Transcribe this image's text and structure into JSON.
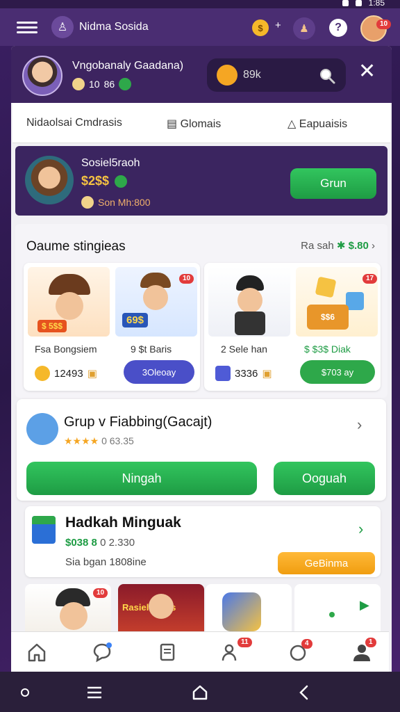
{
  "status": {
    "time": "1:85"
  },
  "topbar": {
    "brand_name": "Nidma Sosida",
    "coin_symbol": "$",
    "plus": "+",
    "help": "?",
    "avatar_badge": "10"
  },
  "profile": {
    "name": "Vngobanaly Gaadana)",
    "level": "10",
    "coins": "86",
    "balance": "89k"
  },
  "tabs": [
    {
      "label": "Nidaolsai Cmdrasis"
    },
    {
      "label": "Glomais"
    },
    {
      "label": "Eapuaisis"
    }
  ],
  "promo": {
    "title": "Sosiel5raoh",
    "amount": "$2$$",
    "sub": "Son Mh:800",
    "button": "Grun"
  },
  "section": {
    "title": "Oaume stingieas",
    "link_label": "Ra sah",
    "link_value": "$.80"
  },
  "game_tiles": [
    {
      "left": {
        "badge": "",
        "art_label": "$ 5$$",
        "name": "Fsa Bongsiem",
        "price": "12493",
        "button": ""
      },
      "right": {
        "badge": "10",
        "art_label": "69$",
        "name": "9 $t Baris",
        "price": "",
        "button": "3Oleoay"
      }
    },
    {
      "left": {
        "badge": "",
        "art_label": "",
        "name": "2 Sele han",
        "price": "3336",
        "button": ""
      },
      "right": {
        "badge": "17",
        "art_label": "$$6",
        "name": "$ $3$ Diak",
        "price": "",
        "button": "$703 ay"
      }
    }
  ],
  "group": {
    "title": "Grup v Fiabbing(Gacajt)",
    "stars": "★★★★",
    "rating_text": "0  63.35",
    "btn_left": "Ningah",
    "btn_right": "Ooguah"
  },
  "hadikah": {
    "title": "Hadkah Minguak",
    "price_green": "$038 8",
    "price_rest": "0  2.330",
    "sub": "Sia bgan 1808ine",
    "button": "GeBinma"
  },
  "strip": {
    "tile1_badge": "10",
    "tile2_label": "Rasiell   Nkos"
  },
  "bottom_nav": {
    "badge_social": "11",
    "badge_notif": "4",
    "badge_profile": "1"
  },
  "colors": {
    "primary_purple": "#4a2d72",
    "accent_green": "#2ea84a",
    "accent_orange": "#f09d10",
    "accent_blue": "#4a4fc8"
  }
}
